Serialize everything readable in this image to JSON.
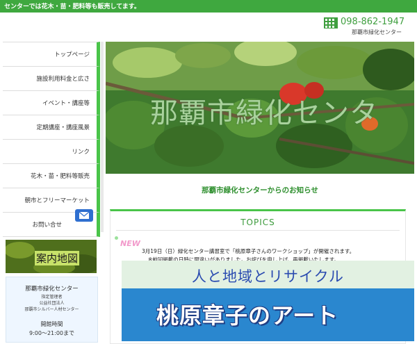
{
  "header": {
    "announcement": "センターでは花木・苗・肥料等も販売してます。",
    "phone": "098-862-1947",
    "organization": "那覇市緑化センター",
    "phone_icon": "building-icon"
  },
  "nav": {
    "items": [
      {
        "label": "トップページ"
      },
      {
        "label": "施設利用料金と広さ"
      },
      {
        "label": "イベント・講座等"
      },
      {
        "label": "定期講座・講座風景"
      },
      {
        "label": "リンク"
      },
      {
        "label": "花木・苗・肥料等販売"
      },
      {
        "label": "朝市とフリーマーケット"
      },
      {
        "label": "お問い合せ"
      }
    ],
    "mail_icon": "mail-icon"
  },
  "hero": {
    "title": "那覇市緑化センタ"
  },
  "notice": {
    "heading": "那覇市緑化センターからのお知らせ"
  },
  "topics": {
    "title": "TOPICS",
    "new_badge": "NEW",
    "items": [
      {
        "line1": "3月19日（日）緑化センター講習室で「桃原章子さんのワークショップ」が開催されます。"
      },
      {
        "line1": "※前回掲載の日時に間違いがありました。お詫びを申し上げ、再掲載いたします。"
      }
    ]
  },
  "banner": {
    "top_text": "人と地域とリサイクル",
    "main_text": "桃原章子のアート"
  },
  "sidebar": {
    "map_label": "案内地図",
    "info": {
      "name": "那覇市緑化センター",
      "manager_label": "指定管理者",
      "corp": "公益社団法人",
      "corp_name": "那覇市シルバー人材センター",
      "hours_label": "開館時間",
      "hours": "9:00～21:00まで"
    }
  },
  "colors": {
    "accent": "#49c449",
    "topbar": "#3fa83f",
    "banner_blue": "#2a87cf"
  }
}
